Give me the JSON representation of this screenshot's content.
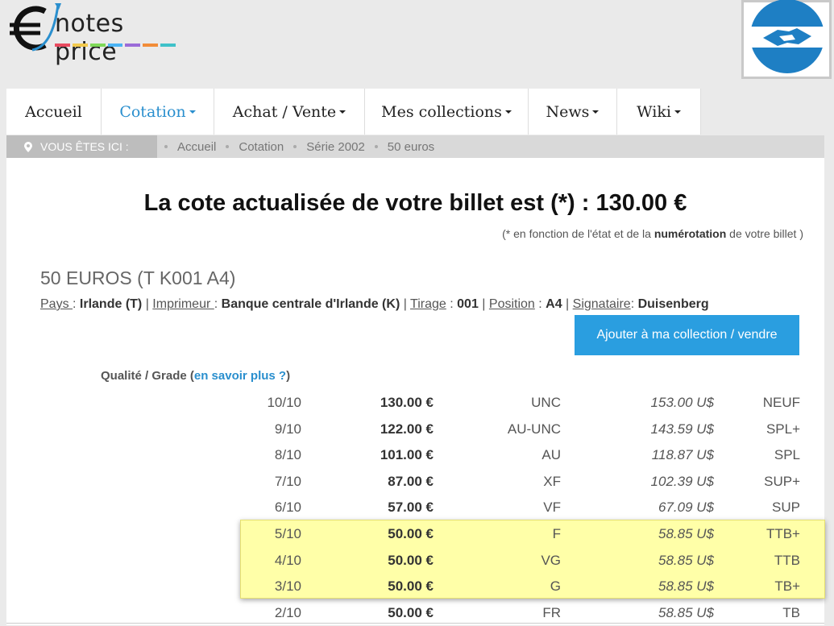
{
  "header": {
    "logo_text": "notes price",
    "logo_symbol": "euro-sign",
    "stripe_colors": [
      "#e84a5f",
      "#f2c94c",
      "#7ed957",
      "#4ab3f4",
      "#9b6bd8",
      "#f28c38",
      "#3fc1c9"
    ]
  },
  "nav": {
    "items": [
      {
        "label": "Accueil",
        "caret": false,
        "active": false
      },
      {
        "label": "Cotation",
        "caret": true,
        "active": true
      },
      {
        "label": "Achat / Vente",
        "caret": true,
        "active": false
      },
      {
        "label": "Mes collections",
        "caret": true,
        "active": false
      },
      {
        "label": "News",
        "caret": true,
        "active": false
      },
      {
        "label": "Wiki",
        "caret": true,
        "active": false
      }
    ]
  },
  "breadcrumb": {
    "you_are_here": "VOUS ÊTES ICI :",
    "items": [
      "Accueil",
      "Cotation",
      "Série 2002",
      "50 euros"
    ]
  },
  "main": {
    "headline": "La cote actualisée de votre billet est (*) : 130.00 €",
    "note_prefix": "(* en fonction de l'état et de la ",
    "note_bold": "numérotation",
    "note_suffix": " de votre billet )",
    "bill_title": "50 EUROS (T K001 A4)",
    "meta": {
      "pays_label": "Pays ",
      "pays_value": "Irlande (T)",
      "imprimeur_label": "Imprimeur ",
      "imprimeur_value": "Banque centrale d'Irlande (K)",
      "tirage_label": "Tirage",
      "tirage_value": "001",
      "position_label": "Position",
      "position_value": "A4",
      "signataire_label": "Signataire",
      "signataire_value": "Duisenberg"
    },
    "add_button": "Ajouter à ma collection / vendre",
    "grade_head_prefix": "Qualité / Grade (",
    "grade_head_link": "en savoir plus ?",
    "grade_head_suffix": ")"
  },
  "grades": [
    {
      "grade": "10/10",
      "eur": "130.00 €",
      "quality": "UNC",
      "usd": "153.00 U$",
      "fr": "NEUF",
      "highlighted": false
    },
    {
      "grade": "9/10",
      "eur": "122.00 €",
      "quality": "AU-UNC",
      "usd": "143.59 U$",
      "fr": "SPL+",
      "highlighted": false
    },
    {
      "grade": "8/10",
      "eur": "101.00 €",
      "quality": "AU",
      "usd": "118.87 U$",
      "fr": "SPL",
      "highlighted": false
    },
    {
      "grade": "7/10",
      "eur": "87.00 €",
      "quality": "XF",
      "usd": "102.39 U$",
      "fr": "SUP+",
      "highlighted": false
    },
    {
      "grade": "6/10",
      "eur": "57.00 €",
      "quality": "VF",
      "usd": "67.09 U$",
      "fr": "SUP",
      "highlighted": false
    },
    {
      "grade": "5/10",
      "eur": "50.00 €",
      "quality": "F",
      "usd": "58.85 U$",
      "fr": "TTB+",
      "highlighted": true
    },
    {
      "grade": "4/10",
      "eur": "50.00 €",
      "quality": "VG",
      "usd": "58.85 U$",
      "fr": "TTB",
      "highlighted": true
    },
    {
      "grade": "3/10",
      "eur": "50.00 €",
      "quality": "G",
      "usd": "58.85 U$",
      "fr": "TB+",
      "highlighted": true
    },
    {
      "grade": "2/10",
      "eur": "50.00 €",
      "quality": "FR",
      "usd": "58.85 U$",
      "fr": "TB",
      "highlighted": false
    }
  ],
  "colors": {
    "accent": "#2a8fce",
    "button": "#2a9ee0",
    "highlight": "#ffffa8",
    "handshake_blue": "#1e7fc4"
  }
}
